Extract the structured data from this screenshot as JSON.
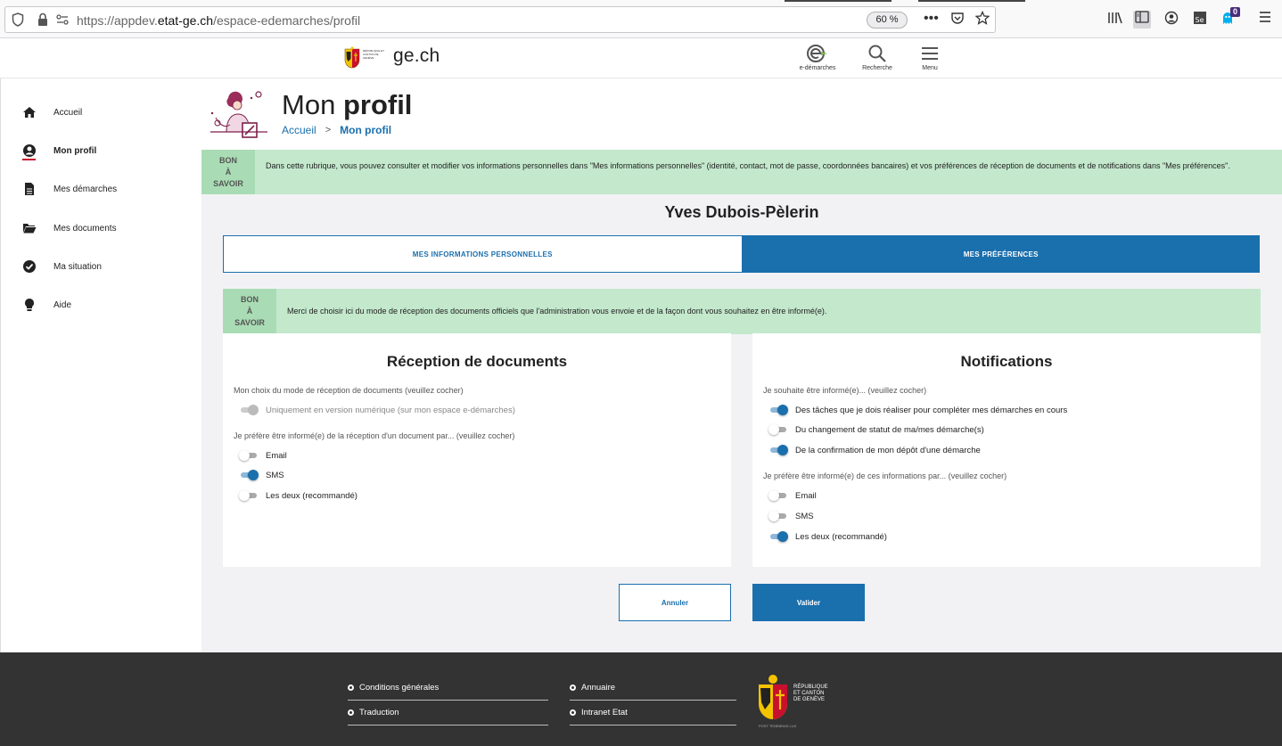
{
  "browser": {
    "url_prefix": "https://appdev.",
    "url_domain": "etat-ge.ch",
    "url_path": "/espace-edemarches/profil",
    "zoom": "60 %",
    "badge_count": "0"
  },
  "header": {
    "site_name": "ge.ch",
    "logo_small_text": "RÉPUBLIQUE ET CANTON DE GENÈVE",
    "edemarches_label": "e-démarches",
    "search_label": "Recherche",
    "menu_label": "Menu"
  },
  "sidebar": {
    "items": [
      {
        "label": "Accueil",
        "icon": "home-icon"
      },
      {
        "label": "Mon profil",
        "icon": "user-icon"
      },
      {
        "label": "Mes démarches",
        "icon": "file-icon"
      },
      {
        "label": "Mes documents",
        "icon": "folder-icon"
      },
      {
        "label": "Ma situation",
        "icon": "check-circle-icon"
      },
      {
        "label": "Aide",
        "icon": "lightbulb-icon"
      }
    ]
  },
  "page": {
    "title_light": "Mon",
    "title_bold": "profil",
    "breadcrumb_home": "Accueil",
    "breadcrumb_sep": ">",
    "breadcrumb_current": "Mon profil"
  },
  "info_top": {
    "tag_l1": "BON",
    "tag_l2": "À",
    "tag_l3": "SAVOIR",
    "text": "Dans cette rubrique, vous pouvez consulter et modifier vos informations personnelles dans \"Mes informations personnelles\" (identité, contact, mot de passe, coordonnées bancaires) et vos préférences de réception de documents et de notifications dans \"Mes préférences\"."
  },
  "user_name": "Yves Dubois-Pèlerin",
  "tabs": {
    "personal": "MES INFORMATIONS PERSONNELLES",
    "preferences": "MES PRÉFÉRENCES"
  },
  "info_prefs": {
    "tag_l1": "BON",
    "tag_l2": "À",
    "tag_l3": "SAVOIR",
    "text": "Merci de choisir ici du mode de réception des documents officiels que l'administration vous envoie et de la façon dont vous souhaitez en être informé(e)."
  },
  "reception": {
    "title": "Réception de documents",
    "q1": "Mon choix du mode de réception de documents (veuillez cocher)",
    "opt_numeric": "Uniquement en version numérique (sur mon espace e-démarches)",
    "q2": "Je préfère être informé(e) de la réception d'un document par... (veuillez cocher)",
    "opt_email": "Email",
    "opt_sms": "SMS",
    "opt_both": "Les deux (recommandé)"
  },
  "notifications": {
    "title": "Notifications",
    "q1": "Je souhaite être informé(e)... (veuillez cocher)",
    "opt_tasks": "Des tâches que je dois réaliser pour compléter mes démarches en cours",
    "opt_status": "Du changement de statut de ma/mes démarche(s)",
    "opt_confirm": "De la confirmation de mon dépôt d'une démarche",
    "q2": "Je préfère être informé(e) de ces informations par... (veuillez cocher)",
    "opt_email": "Email",
    "opt_sms": "SMS",
    "opt_both": "Les deux (recommandé)"
  },
  "actions": {
    "cancel": "Annuler",
    "validate": "Valider"
  },
  "footer": {
    "conditions": "Conditions générales",
    "traduction": "Traduction",
    "annuaire": "Annuaire",
    "intranet": "Intranet Etat",
    "logo_l1": "RÉPUBLIQUE",
    "logo_l2": "ET CANTON",
    "logo_l3": "DE GENÈVE",
    "motto": "POST TENEBRAS LUX"
  },
  "colors": {
    "primary": "#1a6fad",
    "info_bg": "#c3e8cc",
    "footer_bg": "#333333"
  }
}
